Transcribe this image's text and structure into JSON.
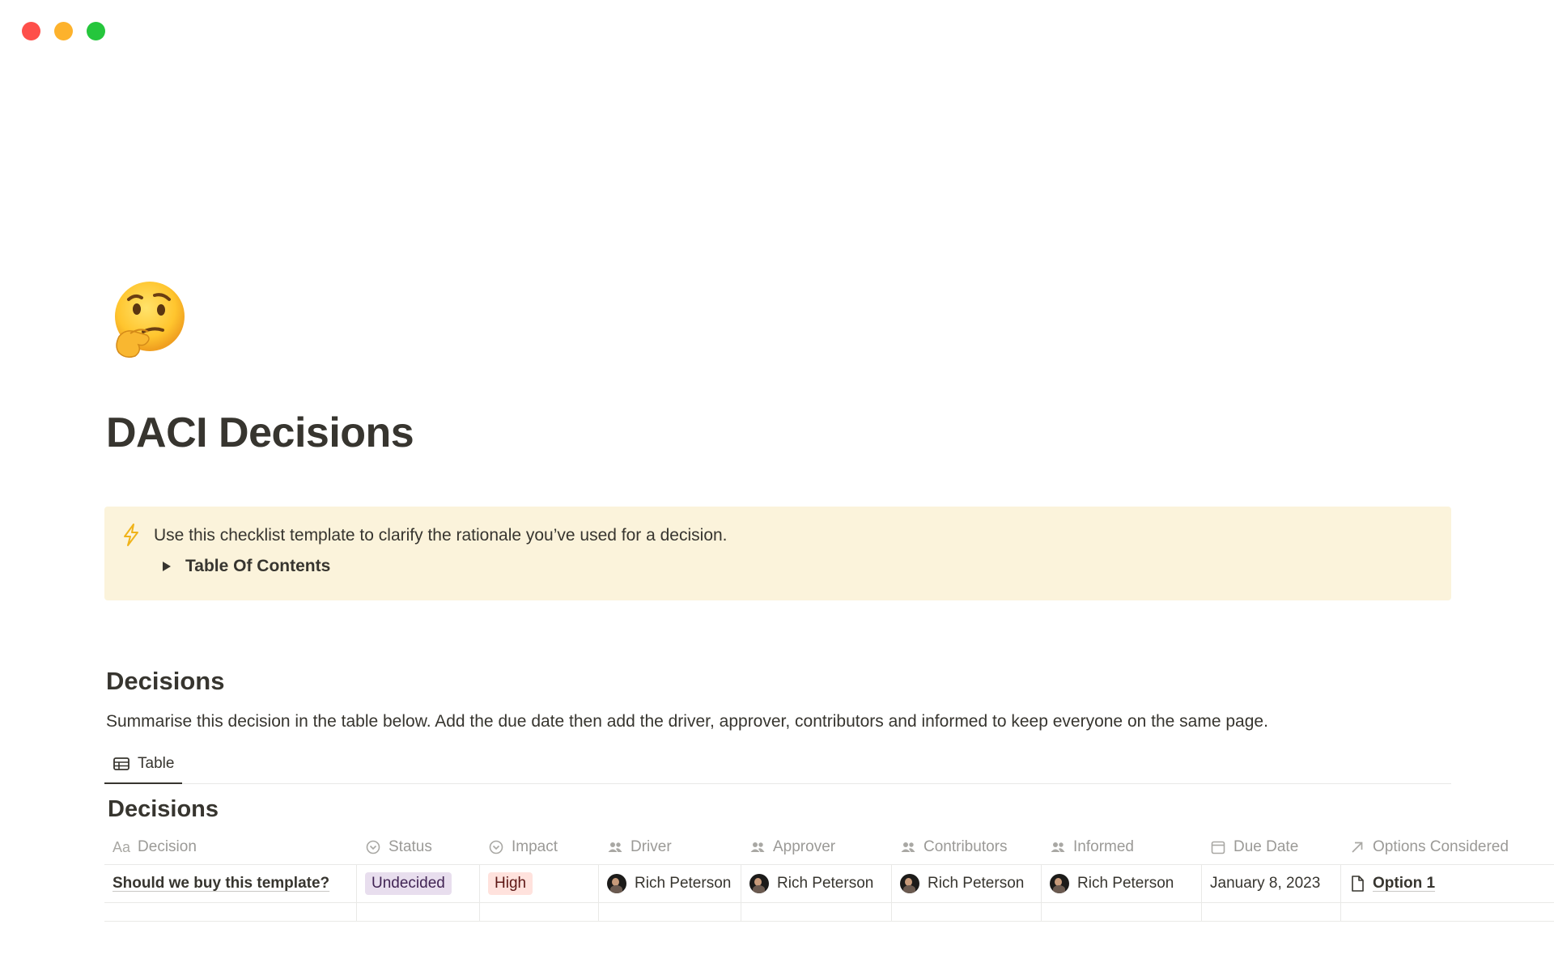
{
  "window": {
    "controls": [
      {
        "name": "close",
        "color": "#fe4f4a"
      },
      {
        "name": "minimize",
        "color": "#fdb22c"
      },
      {
        "name": "maximize",
        "color": "#25c63c"
      }
    ]
  },
  "page": {
    "icon": "thinking-face-emoji",
    "title": "DACI Decisions"
  },
  "callout": {
    "icon": "lightning-icon",
    "text": "Use this checklist template to clarify the rationale you’ve used for a decision.",
    "toggle_label": "Table Of Contents"
  },
  "section": {
    "heading": "Decisions",
    "description": "Summarise this decision in the table below. Add the due date then add the driver, approver, contributors and informed to keep everyone on the same page."
  },
  "database": {
    "view_tab": {
      "label": "Table",
      "icon": "table-icon"
    },
    "title": "Decisions",
    "columns": [
      {
        "label": "Decision",
        "icon": "Aa"
      },
      {
        "label": "Status",
        "icon": "select-icon"
      },
      {
        "label": "Impact",
        "icon": "select-icon"
      },
      {
        "label": "Driver",
        "icon": "people-icon"
      },
      {
        "label": "Approver",
        "icon": "people-icon"
      },
      {
        "label": "Contributors",
        "icon": "people-icon"
      },
      {
        "label": "Informed",
        "icon": "people-icon"
      },
      {
        "label": "Due Date",
        "icon": "calendar-icon"
      },
      {
        "label": "Options Considered",
        "icon": "relation-arrow-icon"
      }
    ],
    "rows": [
      {
        "decision": "Should we buy this template?",
        "status": {
          "label": "Undecided",
          "bg": "#e8deee",
          "fg": "#412454"
        },
        "impact": {
          "label": "High",
          "bg": "#ffe2dd",
          "fg": "#5d1715"
        },
        "driver": "Rich Peterson",
        "approver": "Rich Peterson",
        "contributors": "Rich Peterson",
        "informed": "Rich Peterson",
        "due_date": "January 8, 2023",
        "options_considered": "Option 1"
      }
    ]
  }
}
